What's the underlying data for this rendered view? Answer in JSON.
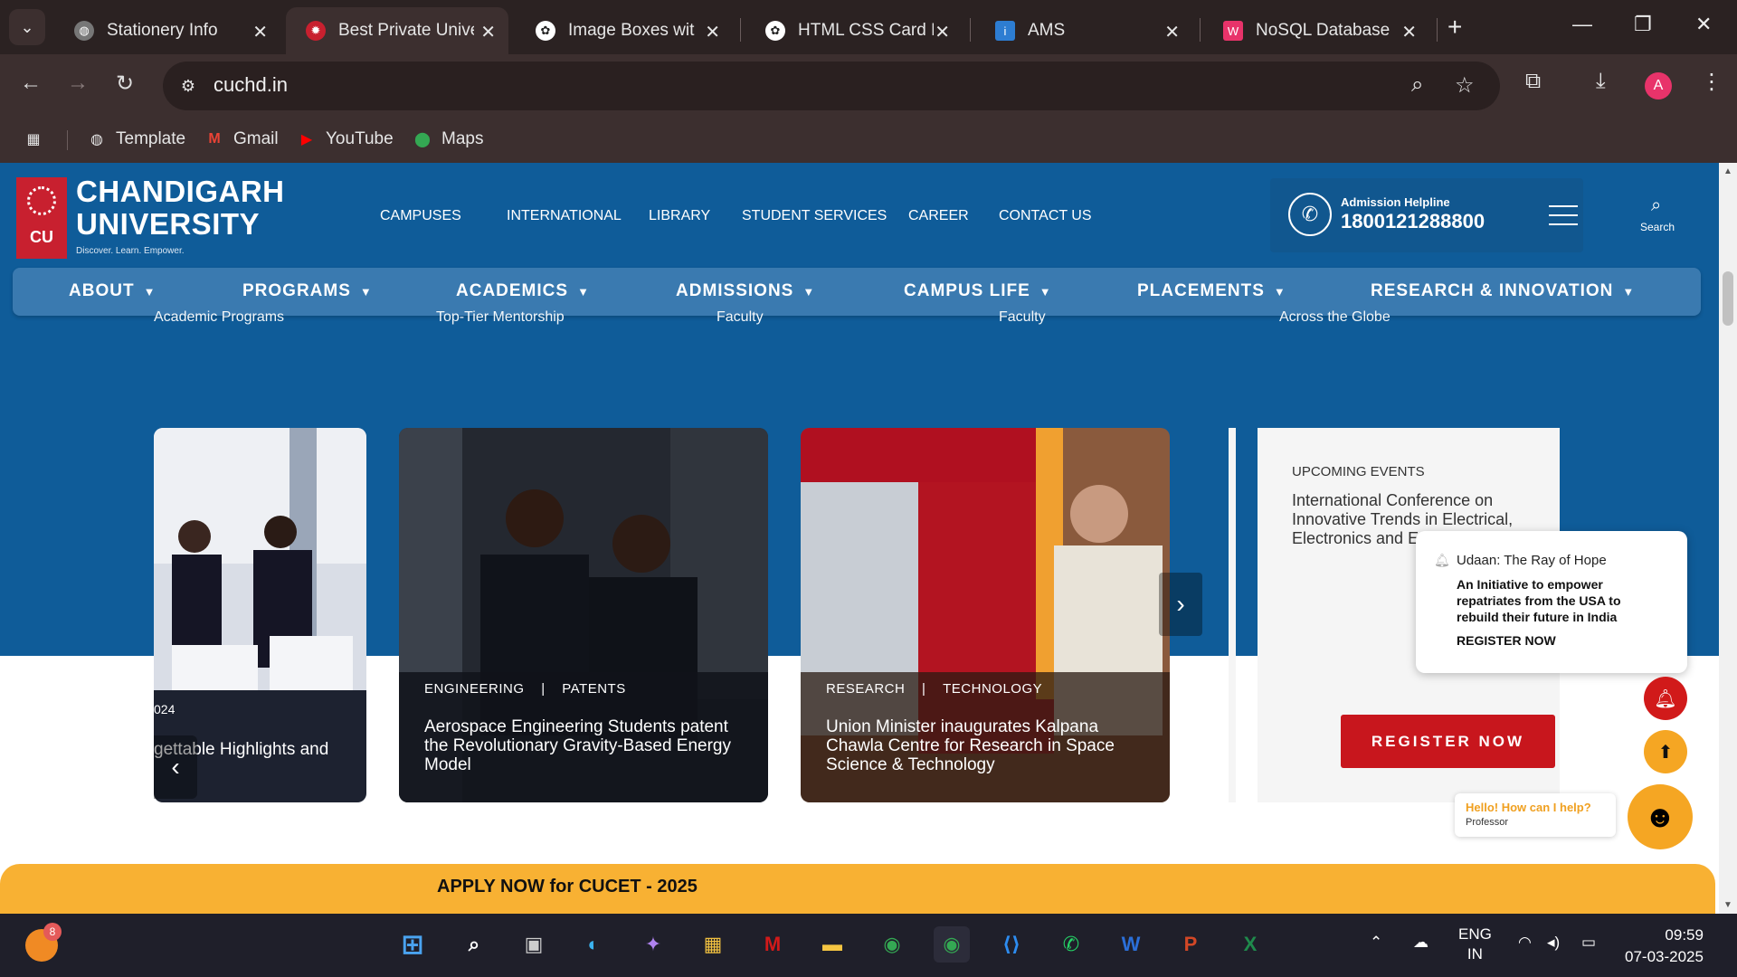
{
  "browser": {
    "tabs": [
      {
        "title": "Stationery Info",
        "active": false
      },
      {
        "title": "Best Private Univer",
        "active": true
      },
      {
        "title": "Image Boxes with",
        "active": false
      },
      {
        "title": "HTML CSS Card De",
        "active": false
      },
      {
        "title": "AMS",
        "active": false
      },
      {
        "title": "NoSQL Database -",
        "active": false
      }
    ],
    "url": "cuchd.in",
    "bookmarks": [
      "Template",
      "Gmail",
      "YouTube",
      "Maps"
    ],
    "profile_initial": "A"
  },
  "site": {
    "logo": {
      "line1": "CHANDIGARH",
      "line2": "UNIVERSITY",
      "emblem": "CU",
      "tagline": "Discover. Learn. Empower."
    },
    "topnav": [
      "CAMPUSES",
      "INTERNATIONAL",
      "LIBRARY",
      "STUDENT SERVICES",
      "CAREER",
      "CONTACT US"
    ],
    "helpline": {
      "label": "Admission Helpline",
      "number": "1800121288800"
    },
    "search_label": "Search",
    "mainnav": [
      "ABOUT",
      "PROGRAMS",
      "ACADEMICS",
      "ADMISSIONS",
      "CAMPUS LIFE",
      "PLACEMENTS",
      "RESEARCH & INNOVATION"
    ],
    "stats": [
      "Academic Programs",
      "Top-Tier Mentorship",
      "Faculty",
      "Faculty",
      "Across the Globe"
    ],
    "cards": [
      {
        "tag1": "",
        "tag2": "",
        "year": "024",
        "title": "gettable Highlights and"
      },
      {
        "tag1": "ENGINEERING",
        "sep": "|",
        "tag2": "PATENTS",
        "title": "Aerospace Engineering Students patent the Revolutionary Gravity-Based Energy Model"
      },
      {
        "tag1": "RESEARCH",
        "sep": "|",
        "tag2": "TECHNOLOGY",
        "title": "Union Minister inaugurates Kalpana Chawla Centre for Research in Space Science & Technology"
      }
    ],
    "events": {
      "heading": "UPCOMING EVENTS",
      "title": "International Conference on Innovative Trends in Electrical, Electronics and Engineering",
      "button": "REGISTER NOW"
    },
    "popup": {
      "heading": "Udaan: The Ray of Hope",
      "body": "An Initiative to empower repatriates from the USA to rebuild their future in India",
      "cta": "REGISTER NOW"
    },
    "chat": {
      "title": "Hello! How can I help?",
      "subtitle": "Professor"
    },
    "apply_bar": "APPLY NOW for CUCET - 2025"
  },
  "taskbar": {
    "badge_count": "8",
    "lang1": "ENG",
    "lang2": "IN",
    "time": "09:59",
    "date": "07-03-2025"
  },
  "colors": {
    "site_blue": "#0f5c99",
    "nav_blue": "#3a7ab0",
    "accent_red": "#c8161d",
    "apply_yellow": "#f8b133"
  }
}
